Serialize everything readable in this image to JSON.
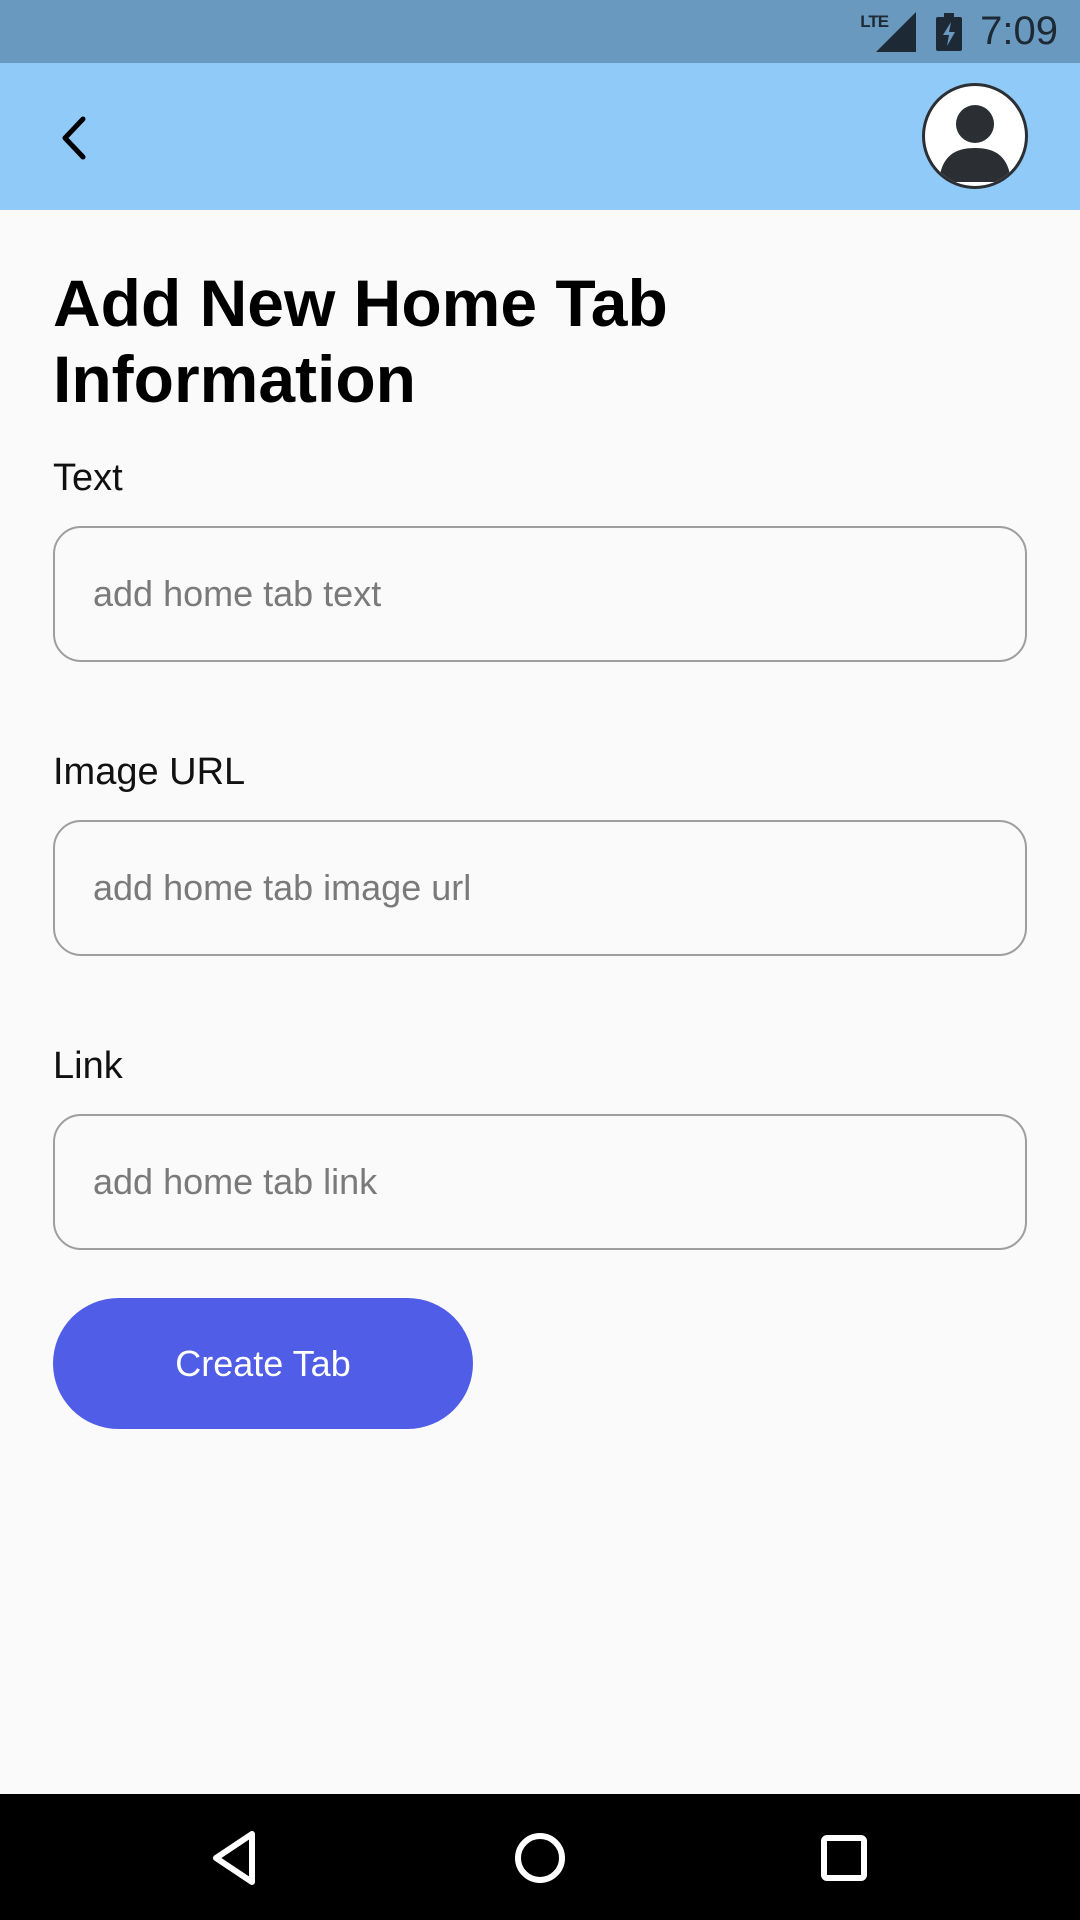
{
  "status_bar": {
    "network": "LTE",
    "time": "7:09"
  },
  "app_bar": {
    "back_icon": "chevron-left-icon",
    "avatar_icon": "user-avatar-icon",
    "color": "#90caf9"
  },
  "page": {
    "title": "Add New Home Tab Information"
  },
  "form": {
    "fields": [
      {
        "label": "Text",
        "placeholder": "add home tab text",
        "value": ""
      },
      {
        "label": "Image URL",
        "placeholder": "add home tab image url",
        "value": ""
      },
      {
        "label": "Link",
        "placeholder": "add home tab link",
        "value": ""
      }
    ],
    "submit_label": "Create Tab",
    "submit_color": "#4f5de7"
  },
  "nav_bar": {
    "back_icon": "nav-back-icon",
    "home_icon": "nav-home-icon",
    "recents_icon": "nav-recents-icon"
  }
}
